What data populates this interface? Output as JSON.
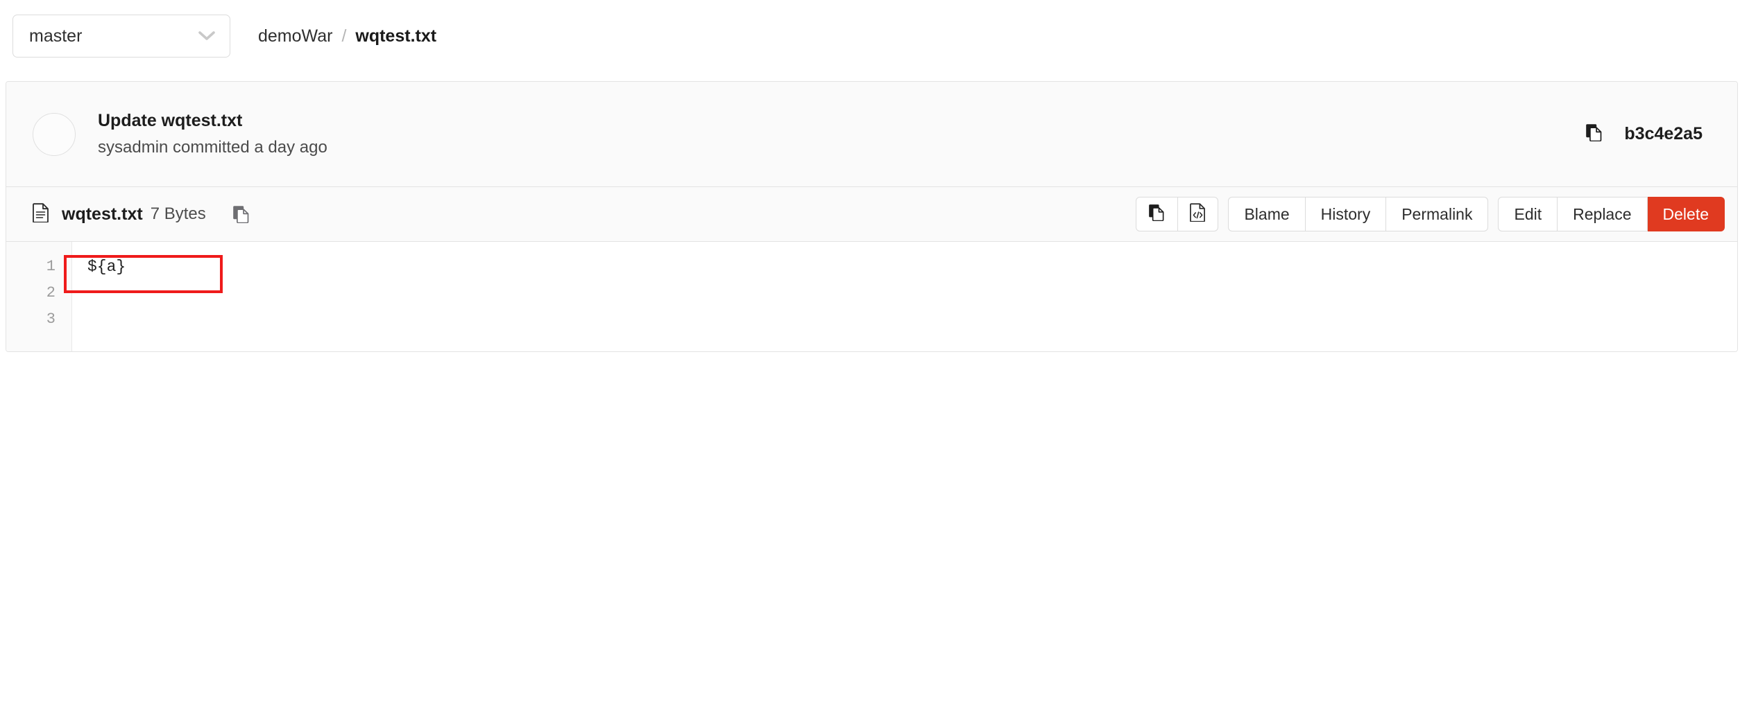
{
  "branch_selector": {
    "value": "master",
    "chevron_icon": "chevron-down-icon"
  },
  "breadcrumb": {
    "repo": "demoWar",
    "separator": "/",
    "file": "wqtest.txt"
  },
  "commit": {
    "message": "Update wqtest.txt",
    "meta": "sysadmin committed a day ago",
    "sha": "b3c4e2a5",
    "copy_icon": "copy-icon",
    "avatar_icon": "avatar"
  },
  "file_header": {
    "file_icon": "file-text-icon",
    "name": "wqtest.txt",
    "size": "7 Bytes",
    "copy_path_icon": "copy-icon",
    "actions": {
      "copy_contents_icon": "copy-icon",
      "raw_code_icon": "code-file-icon",
      "blame": "Blame",
      "history": "History",
      "permalink": "Permalink",
      "edit": "Edit",
      "replace": "Replace",
      "delete": "Delete"
    }
  },
  "code": {
    "line_numbers": [
      "1",
      "2",
      "3"
    ],
    "lines": [
      "${a}",
      "",
      ""
    ]
  },
  "colors": {
    "danger": "#e03a20",
    "annotation": "#ef1b1b",
    "panel_border": "#e3e3e3",
    "header_bg": "#fafafa"
  }
}
